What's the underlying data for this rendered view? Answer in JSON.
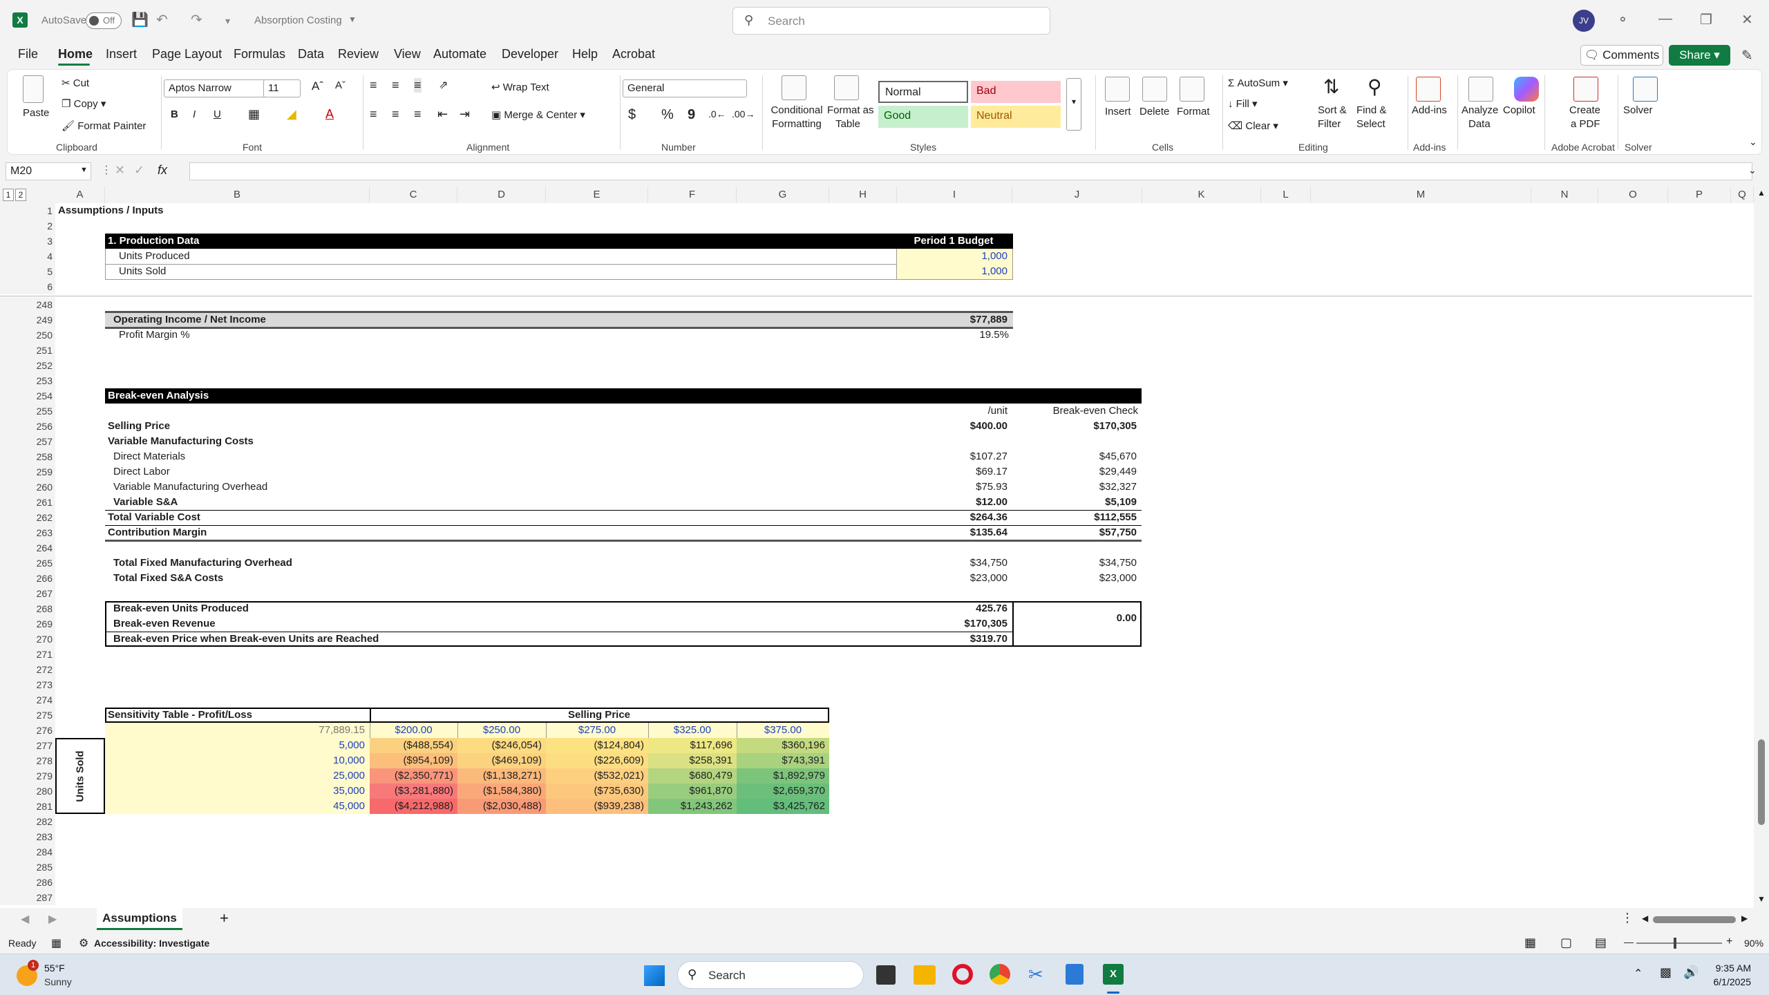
{
  "titlebar": {
    "autosave_label": "AutoSave",
    "autosave_state": "Off",
    "document_title": "Absorption Costing",
    "search_placeholder": "Search",
    "user_initials": "JV"
  },
  "ribbon_tabs": [
    "File",
    "Home",
    "Insert",
    "Page Layout",
    "Formulas",
    "Data",
    "Review",
    "View",
    "Automate",
    "Developer",
    "Help",
    "Acrobat"
  ],
  "ribbon_buttons": {
    "comments": "Comments",
    "share": "Share"
  },
  "ribbon": {
    "clipboard": {
      "paste": "Paste",
      "cut": "Cut",
      "copy": "Copy",
      "format_painter": "Format Painter",
      "group": "Clipboard"
    },
    "font": {
      "name": "Aptos Narrow",
      "size": "11",
      "bold": "B",
      "italic": "I",
      "underline": "U",
      "group": "Font"
    },
    "alignment": {
      "wrap_text": "Wrap Text",
      "merge_center": "Merge & Center",
      "group": "Alignment"
    },
    "number": {
      "format": "General",
      "currency": "$",
      "percent": "%",
      "comma": "9",
      "group": "Number"
    },
    "styles": {
      "conditional": "Conditional",
      "conditional2": "Formatting",
      "format_table": "Format as",
      "format_table2": "Table",
      "normal": "Normal",
      "bad": "Bad",
      "good": "Good",
      "neutral": "Neutral",
      "group": "Styles"
    },
    "cells": {
      "insert": "Insert",
      "delete": "Delete",
      "format": "Format",
      "group": "Cells"
    },
    "editing": {
      "autosum": "AutoSum",
      "fill": "Fill",
      "clear": "Clear",
      "sort1": "Sort &",
      "sort2": "Filter",
      "find1": "Find &",
      "find2": "Select",
      "group": "Editing"
    },
    "addins": {
      "addins": "Add-ins",
      "group": "Add-ins"
    },
    "analyze": {
      "line1": "Analyze",
      "line2": "Data"
    },
    "copilot": "Copilot",
    "acrobat": {
      "line1": "Create",
      "line2": "a PDF",
      "group": "Adobe Acrobat"
    },
    "solver": {
      "label": "Solver",
      "group": "Solver"
    }
  },
  "formula_bar": {
    "name_box": "M20",
    "fx": "fx",
    "content": ""
  },
  "columns": [
    "A",
    "B",
    "C",
    "D",
    "E",
    "F",
    "G",
    "H",
    "I",
    "J",
    "K",
    "L",
    "M",
    "N",
    "O",
    "P",
    "Q"
  ],
  "outline_levels": [
    "1",
    "2"
  ],
  "rows_top": [
    "1",
    "2",
    "3",
    "4",
    "5",
    "6"
  ],
  "rows_main": [
    "248",
    "249",
    "250",
    "251",
    "252",
    "253",
    "254",
    "255",
    "256",
    "257",
    "258",
    "259",
    "260",
    "261",
    "262",
    "263",
    "264",
    "265",
    "266",
    "267",
    "268",
    "269",
    "270",
    "271",
    "272",
    "273",
    "274",
    "275",
    "276",
    "277",
    "278",
    "279",
    "280",
    "281",
    "282",
    "283",
    "284",
    "285",
    "286",
    "287"
  ],
  "sheet": {
    "title": "Assumptions / Inputs",
    "production_header": "1. Production Data",
    "period_header": "Period 1 Budget",
    "units_produced_label": "Units Produced",
    "units_produced": "1,000",
    "units_sold_label": "Units Sold",
    "units_sold": "1,000",
    "op_income_label": "Operating Income / Net Income",
    "op_income": "$77,889",
    "profit_margin_label": "Profit Margin %",
    "profit_margin": "19.5%",
    "breakeven_header": "Break-even Analysis",
    "per_unit_header": "/unit",
    "check_header": "Break-even Check",
    "breakeven_rows": [
      {
        "label": "Selling Price",
        "unit": "$400.00",
        "check": "$170,305",
        "bold": true
      },
      {
        "label": "Variable Manufacturing Costs",
        "unit": "",
        "check": "",
        "bold": true
      },
      {
        "label": "Direct Materials",
        "unit": "$107.27",
        "check": "$45,670",
        "bold": false
      },
      {
        "label": "Direct Labor",
        "unit": "$69.17",
        "check": "$29,449",
        "bold": false
      },
      {
        "label": "Variable Manufacturing Overhead",
        "unit": "$75.93",
        "check": "$32,327",
        "bold": false
      },
      {
        "label": "Variable S&A",
        "unit": "$12.00",
        "check": "$5,109",
        "bold": true
      },
      {
        "label": "Total Variable Cost",
        "unit": "$264.36",
        "check": "$112,555",
        "bold": true
      },
      {
        "label": "Contribution Margin",
        "unit": "$135.64",
        "check": "$57,750",
        "bold": true
      }
    ],
    "fixed_mfg_label": "Total Fixed Manufacturing Overhead",
    "fixed_mfg": "$34,750",
    "fixed_mfg_check": "$34,750",
    "fixed_sa_label": "Total Fixed S&A Costs",
    "fixed_sa": "$23,000",
    "fixed_sa_check": "$23,000",
    "be_units_label": "Break-even Units Produced",
    "be_units": "425.76",
    "be_revenue_label": "Break-even Revenue",
    "be_revenue": "$170,305",
    "be_price_label": "Break-even Price when Break-even Units are Reached",
    "be_price": "$319.70",
    "be_check_value": "0.00",
    "sensitivity_header": "Sensitivity Table - Profit/Loss",
    "selling_price_header": "Selling Price",
    "corner_value": "77,889.15",
    "price_points": [
      "$200.00",
      "$250.00",
      "$275.00",
      "$325.00",
      "$375.00"
    ],
    "units_sold_axis": "Units Sold",
    "sensitivity_rows": [
      {
        "units": "5,000",
        "values": [
          "($488,554)",
          "($246,054)",
          "($124,804)",
          "$117,696",
          "$360,196"
        ]
      },
      {
        "units": "10,000",
        "values": [
          "($954,109)",
          "($469,109)",
          "($226,609)",
          "$258,391",
          "$743,391"
        ]
      },
      {
        "units": "25,000",
        "values": [
          "($2,350,771)",
          "($1,138,271)",
          "($532,021)",
          "$680,479",
          "$1,892,979"
        ]
      },
      {
        "units": "35,000",
        "values": [
          "($3,281,880)",
          "($1,584,380)",
          "($735,630)",
          "$961,870",
          "$2,659,370"
        ]
      },
      {
        "units": "45,000",
        "values": [
          "($4,212,988)",
          "($2,030,488)",
          "($939,238)",
          "$1,243,262",
          "$3,425,762"
        ]
      }
    ],
    "heat_colors": [
      [
        "#fbd17f",
        "#fddb81",
        "#fde282",
        "#ede784",
        "#c4da7f"
      ],
      [
        "#fbbe7b",
        "#fcd27f",
        "#fddd81",
        "#dbe182",
        "#a9d27f"
      ],
      [
        "#f9957a",
        "#fbb97b",
        "#fdd07f",
        "#b4d580",
        "#7cc47c"
      ],
      [
        "#f7797a",
        "#faa879",
        "#fcc87d",
        "#99cd7e",
        "#6bbf7b"
      ],
      [
        "#f8696b",
        "#f99a77",
        "#fcc07c",
        "#82c67c",
        "#63be7b"
      ]
    ]
  },
  "sheet_tabs": {
    "active": "Assumptions",
    "add": "+"
  },
  "status": {
    "ready": "Ready",
    "accessibility": "Accessibility: Investigate",
    "zoom": "90%"
  },
  "taskbar": {
    "temp": "55°F",
    "weather": "Sunny",
    "search": "Search",
    "time": "9:35 AM",
    "date": "6/1/2025",
    "weather_badge": "1"
  }
}
